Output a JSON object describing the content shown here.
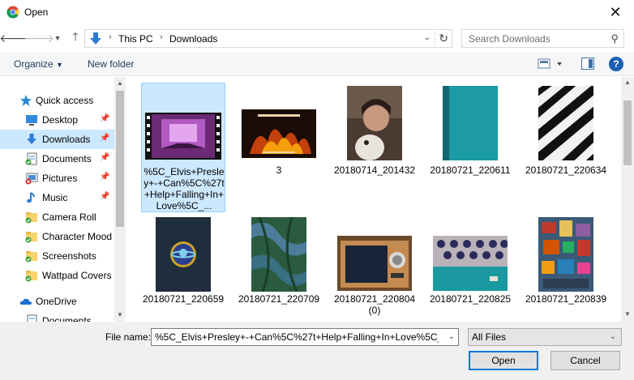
{
  "window": {
    "title": "Open"
  },
  "address": {
    "crumbs": [
      "This PC",
      "Downloads"
    ]
  },
  "search": {
    "placeholder": "Search Downloads"
  },
  "toolbar": {
    "organize": "Organize",
    "new_folder": "New folder"
  },
  "nav": {
    "items": [
      {
        "label": "Quick access",
        "icon": "star-icon"
      },
      {
        "label": "Desktop",
        "icon": "desktop-icon",
        "pinned": true
      },
      {
        "label": "Downloads",
        "icon": "download-arrow-icon",
        "pinned": true,
        "selected": true
      },
      {
        "label": "Documents",
        "icon": "documents-icon",
        "pinned": true
      },
      {
        "label": "Pictures",
        "icon": "pictures-icon",
        "pinned": true
      },
      {
        "label": "Music",
        "icon": "music-icon",
        "pinned": true
      },
      {
        "label": "Camera Roll",
        "icon": "folder-icon"
      },
      {
        "label": "Character Mood",
        "icon": "folder-icon"
      },
      {
        "label": "Screenshots",
        "icon": "folder-icon"
      },
      {
        "label": "Wattpad Covers",
        "icon": "folder-icon"
      },
      {
        "label": "OneDrive",
        "icon": "cloud-icon"
      },
      {
        "label": "Documents",
        "icon": "documents-icon"
      }
    ]
  },
  "files": [
    {
      "name": "%5C_Elvis+Presley+-+Can%5C%27t+Help+Falling+In+Love%5C_...",
      "kind": "video",
      "selected": true
    },
    {
      "name": "3",
      "kind": "image"
    },
    {
      "name": "20180714_201432",
      "kind": "image"
    },
    {
      "name": "20180721_220611",
      "kind": "image"
    },
    {
      "name": "20180721_220634",
      "kind": "image"
    },
    {
      "name": "20180721_220659",
      "kind": "image"
    },
    {
      "name": "20180721_220709",
      "kind": "image"
    },
    {
      "name": "20180721_220804 (0)",
      "kind": "image"
    },
    {
      "name": "20180721_220825",
      "kind": "image"
    },
    {
      "name": "20180721_220839",
      "kind": "image"
    }
  ],
  "footer": {
    "file_name_label": "File name:",
    "file_name_value": "%5C_Elvis+Presley+-+Can%5C%27t+Help+Falling+In+Love%5C_+",
    "file_type": "All Files",
    "open": "Open",
    "cancel": "Cancel"
  },
  "colors": {
    "selection": "#cce8ff",
    "accent": "#0078d7"
  }
}
